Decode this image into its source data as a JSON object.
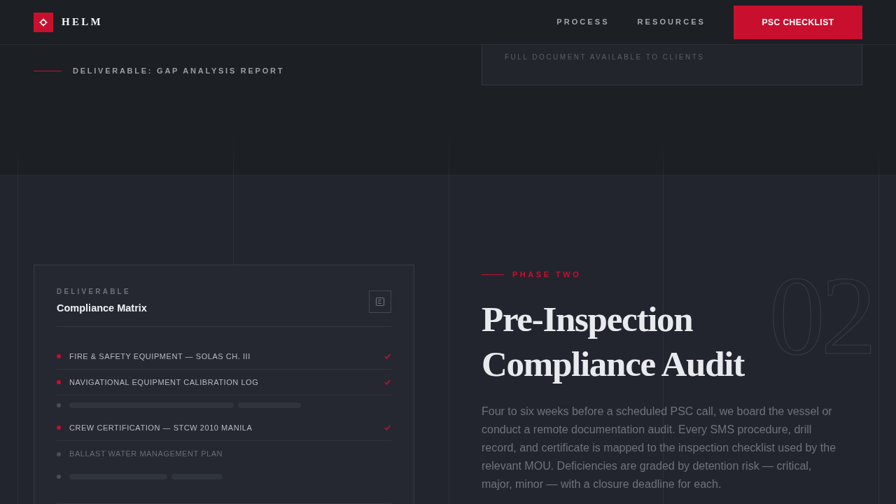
{
  "header": {
    "brand": "HELM",
    "nav": [
      "PROCESS",
      "RESOURCES"
    ],
    "cta": "PSC CHECKLIST"
  },
  "previous_section": {
    "deliverable_label": "DELIVERABLE: GAP ANALYSIS REPORT",
    "card_note": "FULL DOCUMENT AVAILABLE TO CLIENTS"
  },
  "matrix_card": {
    "eyebrow": "DELIVERABLE",
    "title": "Compliance Matrix",
    "items": [
      {
        "kind": "item",
        "label": "FIRE & SAFETY EQUIPMENT — SOLAS CH. III",
        "checked": true
      },
      {
        "kind": "item",
        "label": "NAVIGATIONAL EQUIPMENT CALIBRATION LOG",
        "checked": true
      },
      {
        "kind": "placeholder"
      },
      {
        "kind": "item",
        "label": "CREW CERTIFICATION — STCW 2010 MANILA",
        "checked": true
      },
      {
        "kind": "item",
        "label": "BALLAST WATER MANAGEMENT PLAN",
        "checked": false
      },
      {
        "kind": "placeholder"
      }
    ]
  },
  "phase": {
    "eyebrow": "PHASE TWO",
    "number": "02",
    "title": "Pre-Inspection Compliance Audit",
    "body": "Four to six weeks before a scheduled PSC call, we board the vessel or conduct a remote documentation audit. Every SMS procedure, drill record, and certificate is mapped to the inspection checklist used by the relevant MOU. Deficiencies are graded by detention risk — critical, major, minor — with a closure deadline for each."
  }
}
